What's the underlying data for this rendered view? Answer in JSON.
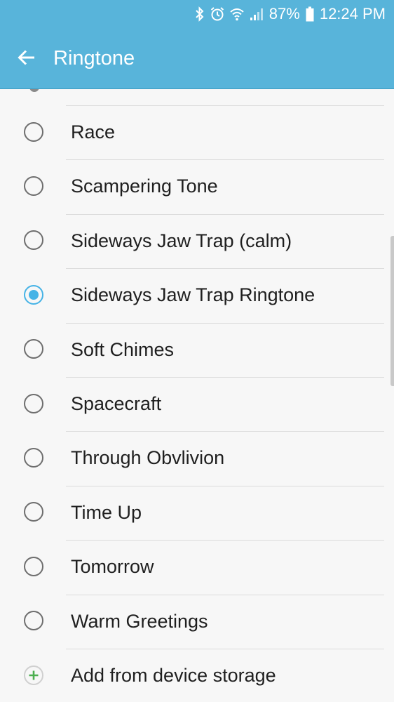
{
  "status_bar": {
    "battery_percent": "87%",
    "time": "12:24 PM",
    "icons": [
      "bluetooth-icon",
      "alarm-icon",
      "wifi-icon",
      "signal-icon",
      "battery-icon"
    ]
  },
  "header": {
    "back_icon": "arrow-left-icon",
    "title": "Ringtone"
  },
  "ringtones": [
    {
      "label": "Race",
      "selected": false
    },
    {
      "label": "Scampering Tone",
      "selected": false
    },
    {
      "label": "Sideways Jaw Trap (calm)",
      "selected": false
    },
    {
      "label": "Sideways Jaw Trap Ringtone",
      "selected": true
    },
    {
      "label": "Soft Chimes",
      "selected": false
    },
    {
      "label": "Spacecraft",
      "selected": false
    },
    {
      "label": "Through Obvlivion",
      "selected": false
    },
    {
      "label": "Time Up",
      "selected": false
    },
    {
      "label": "Tomorrow",
      "selected": false
    },
    {
      "label": "Warm Greetings",
      "selected": false
    }
  ],
  "add_from_storage": {
    "label": "Add from device storage",
    "icon": "plus-icon"
  },
  "colors": {
    "app_bar": "#58b4da",
    "accent": "#46b3e6",
    "add_icon": "#4caf50"
  }
}
